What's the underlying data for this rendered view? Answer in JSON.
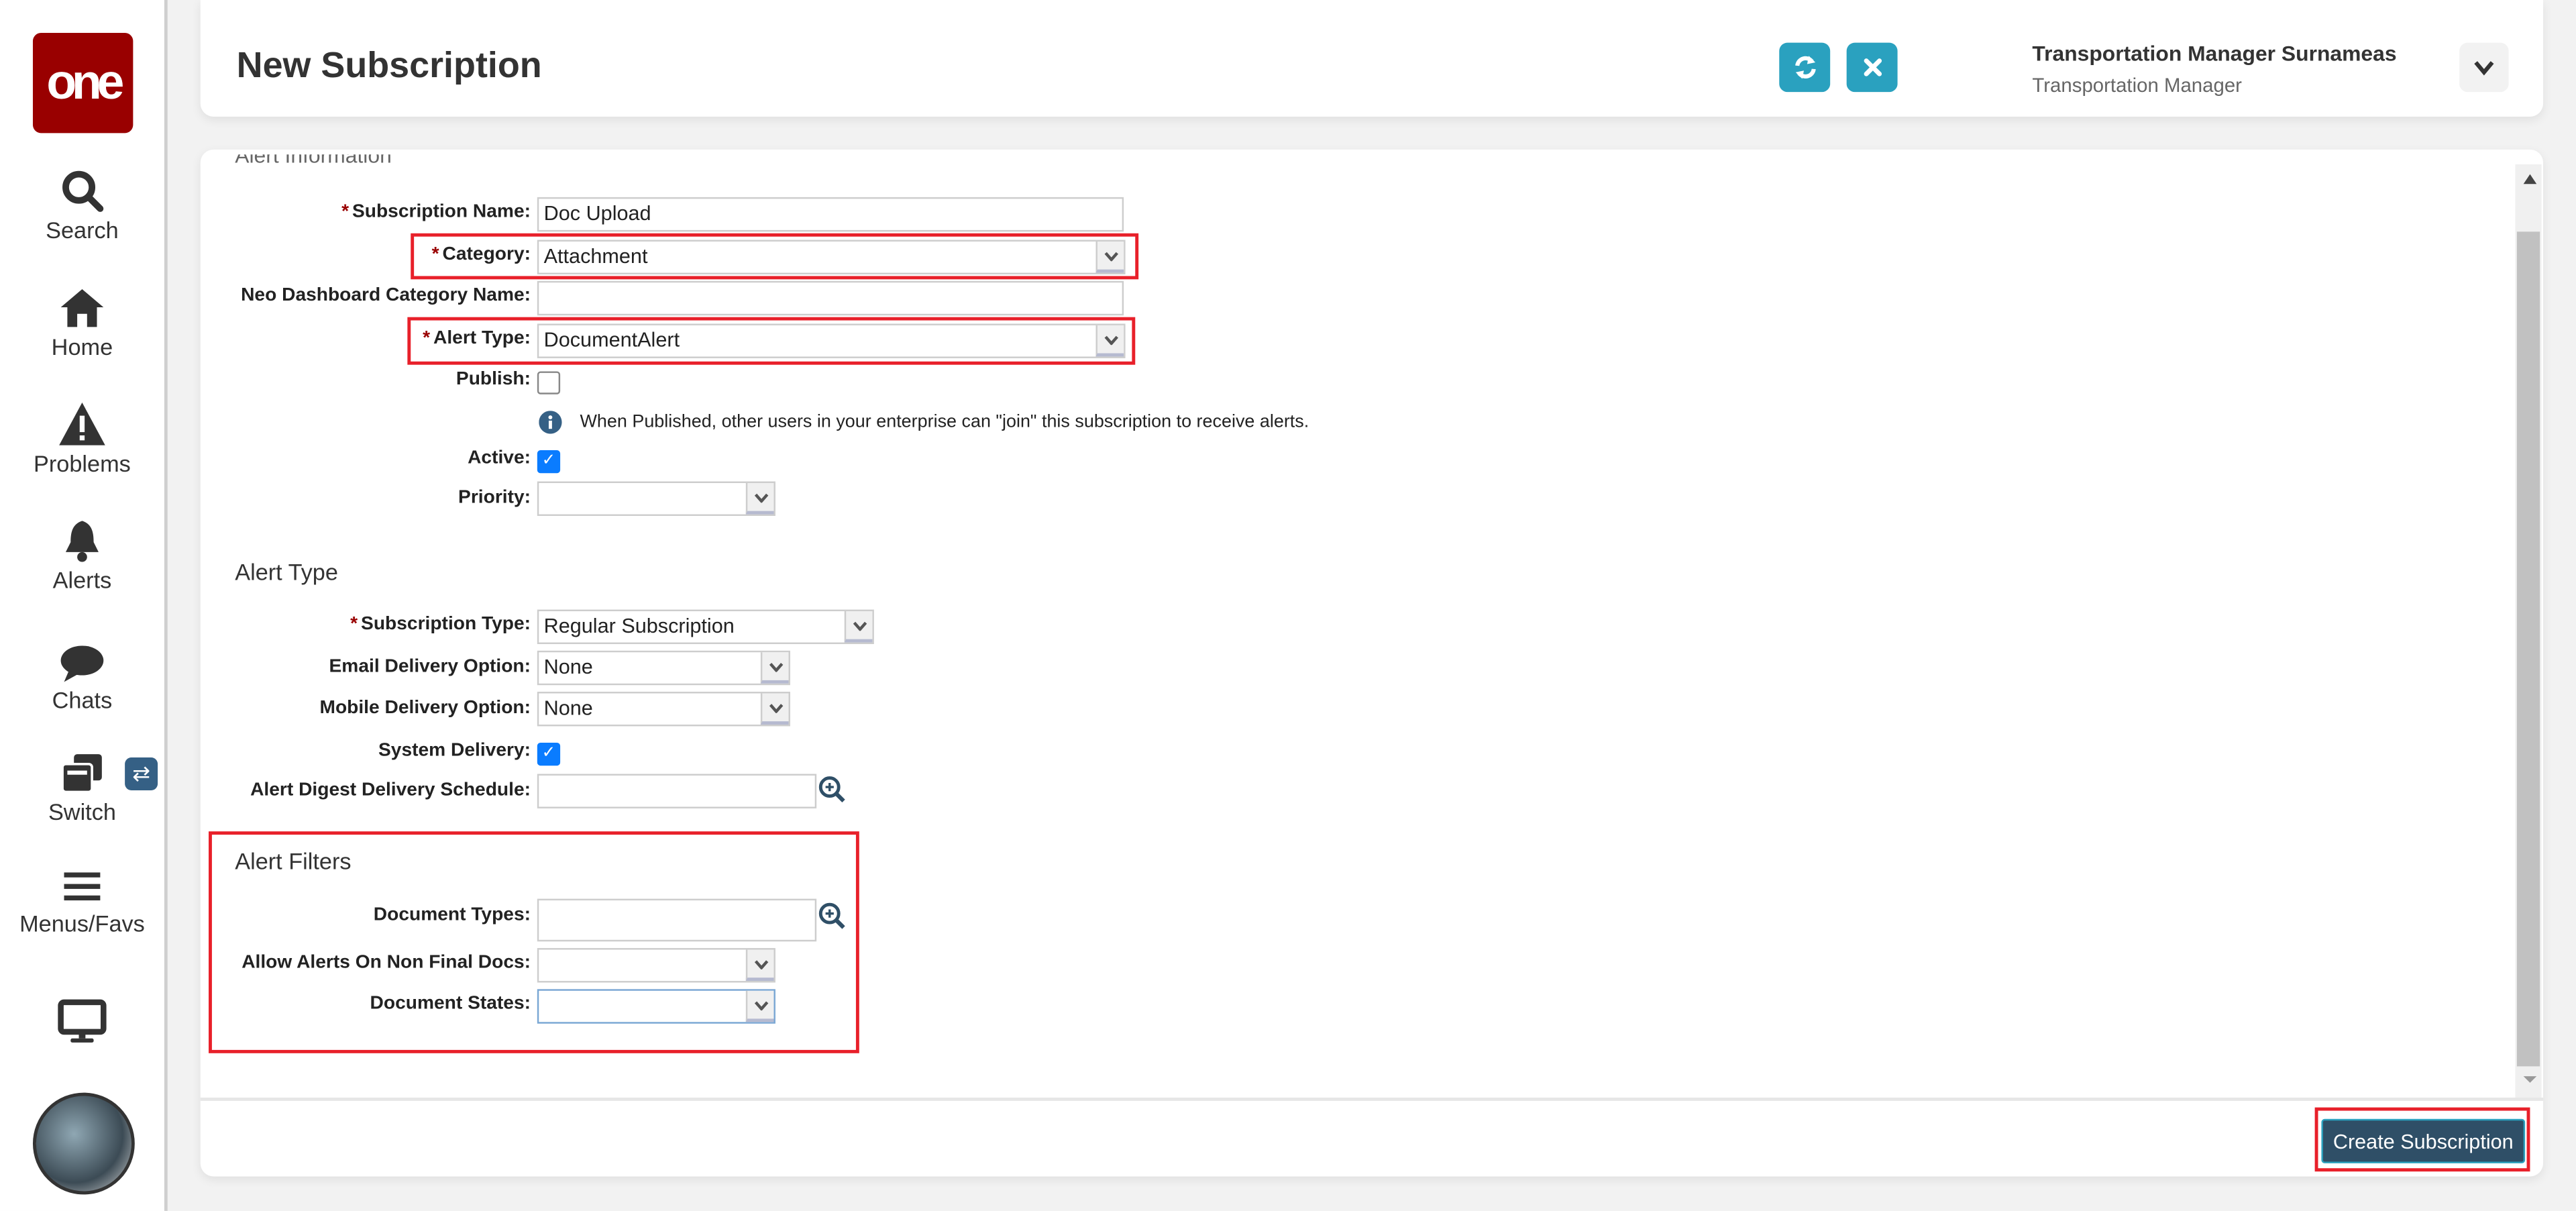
{
  "sidebar": {
    "logo": "one",
    "items": [
      {
        "label": "Search",
        "icon": "search-icon"
      },
      {
        "label": "Home",
        "icon": "home-icon"
      },
      {
        "label": "Problems",
        "icon": "warning-icon"
      },
      {
        "label": "Alerts",
        "icon": "bell-icon"
      },
      {
        "label": "Chats",
        "icon": "chat-icon"
      },
      {
        "label": "Switch",
        "icon": "switch-icon"
      },
      {
        "label": "Menus/Favs",
        "icon": "menu-icon"
      },
      {
        "label": "",
        "icon": "monitor-icon"
      }
    ],
    "switch_badge": "⇄"
  },
  "header": {
    "title": "New Subscription",
    "user_name": "Transportation Manager Surnameas",
    "user_role": "Transportation Manager"
  },
  "form": {
    "section1_partial": "Alert Information",
    "subscription_name": {
      "label": "Subscription Name:",
      "value": "Doc Upload"
    },
    "category": {
      "label": "Category:",
      "value": "Attachment"
    },
    "neo_category": {
      "label": "Neo Dashboard Category Name:",
      "value": ""
    },
    "alert_type": {
      "label": "Alert Type:",
      "value": "DocumentAlert"
    },
    "publish": {
      "label": "Publish:",
      "checked": false
    },
    "publish_info": "When Published, other users in your enterprise can \"join\" this subscription to receive alerts.",
    "active": {
      "label": "Active:",
      "checked": true
    },
    "priority": {
      "label": "Priority:",
      "value": ""
    },
    "section2": "Alert Type",
    "subscription_type": {
      "label": "Subscription Type:",
      "value": "Regular Subscription"
    },
    "email_delivery": {
      "label": "Email Delivery Option:",
      "value": "None"
    },
    "mobile_delivery": {
      "label": "Mobile Delivery Option:",
      "value": "None"
    },
    "system_delivery": {
      "label": "System Delivery:",
      "checked": true
    },
    "digest_schedule": {
      "label": "Alert Digest Delivery Schedule:",
      "value": ""
    },
    "section3": "Alert Filters",
    "document_types": {
      "label": "Document Types:",
      "value": ""
    },
    "allow_non_final": {
      "label": "Allow Alerts On Non Final Docs:",
      "value": ""
    },
    "document_states": {
      "label": "Document States:",
      "value": ""
    },
    "required_mark": "*"
  },
  "footer": {
    "create_label": "Create Subscription"
  },
  "colors": {
    "brand": "#990000",
    "accent": "#2aa1bf",
    "primary_button": "#2f4f67",
    "highlight": "#e8202a"
  }
}
